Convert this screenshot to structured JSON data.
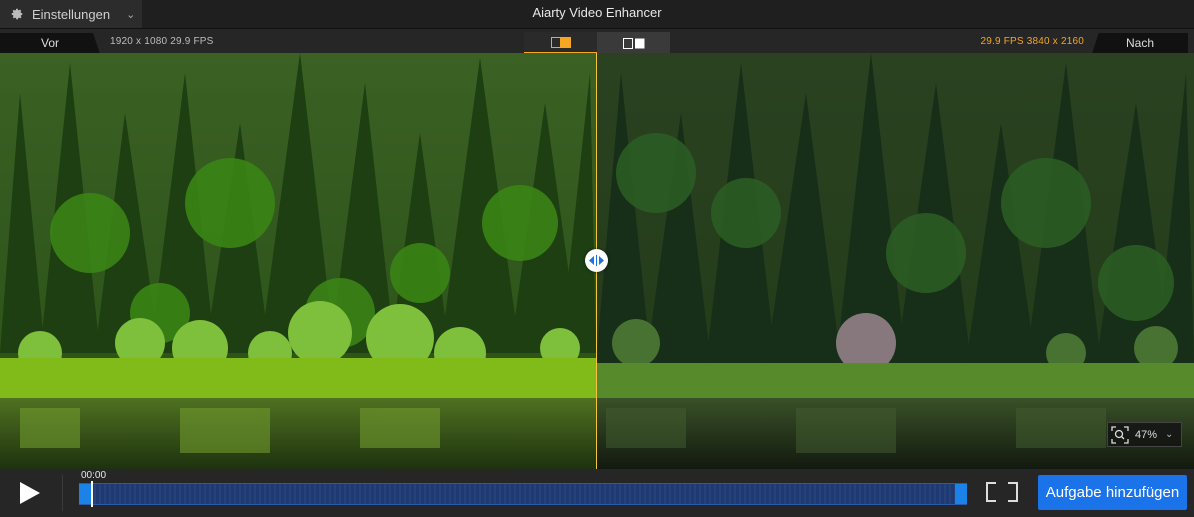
{
  "window": {
    "title": "Aiarty Video Enhancer",
    "settings_label": "Einstellungen"
  },
  "compare": {
    "before_label": "Vor",
    "after_label": "Nach",
    "source_info": "1920 x 1080  29.9 FPS",
    "output_info": "29.9 FPS  3840 x 2160",
    "active_view": "split"
  },
  "preview": {
    "zoom": "47%"
  },
  "playback": {
    "time": "00:00",
    "add_task_label": "Aufgabe hinzufügen"
  },
  "colors": {
    "accent": "#f5a623",
    "primary_button": "#1a73e8",
    "timeline": "#1d3a72",
    "divider": "#f5c542"
  }
}
